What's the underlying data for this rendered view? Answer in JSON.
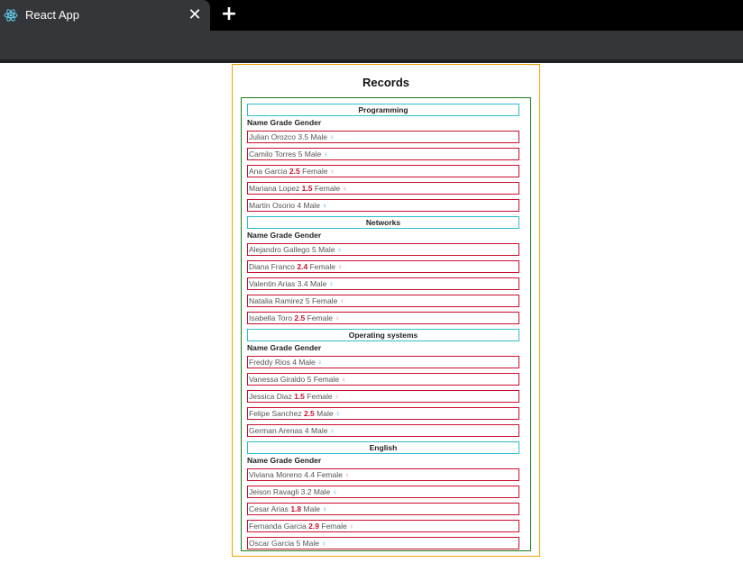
{
  "browser": {
    "tab_title": "React App",
    "close_glyph": "✕",
    "new_tab_glyph": "+",
    "favicon": "react-logo-icon"
  },
  "page": {
    "title": "Records",
    "column_header": "Name Grade Gender",
    "low_grade_color": "#c8102e",
    "male_icon_color": "#4fb3e6",
    "female_icon_color": "#f08a9e"
  },
  "groups": [
    {
      "subject": "Programming",
      "students": [
        {
          "name": "Julian Orozco",
          "grade": "3.5",
          "gender": "Male",
          "low": false
        },
        {
          "name": "Camilo Torres",
          "grade": "5",
          "gender": "Male",
          "low": false
        },
        {
          "name": "Ana Garcia",
          "grade": "2.5",
          "gender": "Female",
          "low": true
        },
        {
          "name": "Mariana Lopez",
          "grade": "1.5",
          "gender": "Female",
          "low": true
        },
        {
          "name": "Martin Osorio",
          "grade": "4",
          "gender": "Male",
          "low": false
        }
      ]
    },
    {
      "subject": "Networks",
      "students": [
        {
          "name": "Alejandro Gallego",
          "grade": "5",
          "gender": "Male",
          "low": false
        },
        {
          "name": "Diana Franco",
          "grade": "2.4",
          "gender": "Female",
          "low": true
        },
        {
          "name": "Valentin Arias",
          "grade": "3.4",
          "gender": "Male",
          "low": false
        },
        {
          "name": "Natalia Ramirez",
          "grade": "5",
          "gender": "Female",
          "low": false
        },
        {
          "name": "Isabella Toro",
          "grade": "2.5",
          "gender": "Female",
          "low": true
        }
      ]
    },
    {
      "subject": "Operating systems",
      "students": [
        {
          "name": "Freddy Rios",
          "grade": "4",
          "gender": "Male",
          "low": false
        },
        {
          "name": "Vanessa Giraldo",
          "grade": "5",
          "gender": "Female",
          "low": false
        },
        {
          "name": "Jessica Diaz",
          "grade": "1.5",
          "gender": "Female",
          "low": true
        },
        {
          "name": "Felipe Sanchez",
          "grade": "2.5",
          "gender": "Male",
          "low": true
        },
        {
          "name": "German Arenas",
          "grade": "4",
          "gender": "Male",
          "low": false
        }
      ]
    },
    {
      "subject": "English",
      "students": [
        {
          "name": "Viviana Moreno",
          "grade": "4.4",
          "gender": "Female",
          "low": false
        },
        {
          "name": "Jeison Ravagli",
          "grade": "3.2",
          "gender": "Male",
          "low": false
        },
        {
          "name": "Cesar Arias",
          "grade": "1.8",
          "gender": "Male",
          "low": true
        },
        {
          "name": "Fernanda Garcia",
          "grade": "2.9",
          "gender": "Female",
          "low": true
        },
        {
          "name": "Oscar Garcia",
          "grade": "5",
          "gender": "Male",
          "low": false
        }
      ]
    }
  ]
}
